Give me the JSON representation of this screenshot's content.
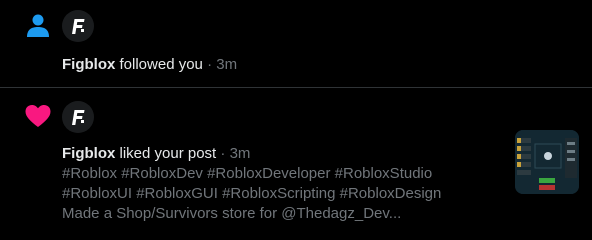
{
  "colors": {
    "background": "#000000",
    "divider": "#2f3336",
    "primary_text": "#e7e9ea",
    "secondary_text": "#71767b",
    "follow_icon": "#1d9bf0",
    "like_icon": "#f91880"
  },
  "notifications": [
    {
      "type": "follow",
      "type_icon": "person-icon",
      "actor": "Figblox",
      "action": "followed you",
      "separator": "·",
      "time": "3m"
    },
    {
      "type": "like",
      "type_icon": "heart-icon",
      "actor": "Figblox",
      "action": "liked your post",
      "separator": "·",
      "time": "3m",
      "post_lines": [
        "#Roblox #RobloxDev #RobloxDeveloper #RobloxStudio",
        "#RobloxUI #RobloxGUI #RobloxScripting #RobloxDesign",
        "Made a Shop/Survivors store for @Thedagz_Dev..."
      ]
    }
  ]
}
